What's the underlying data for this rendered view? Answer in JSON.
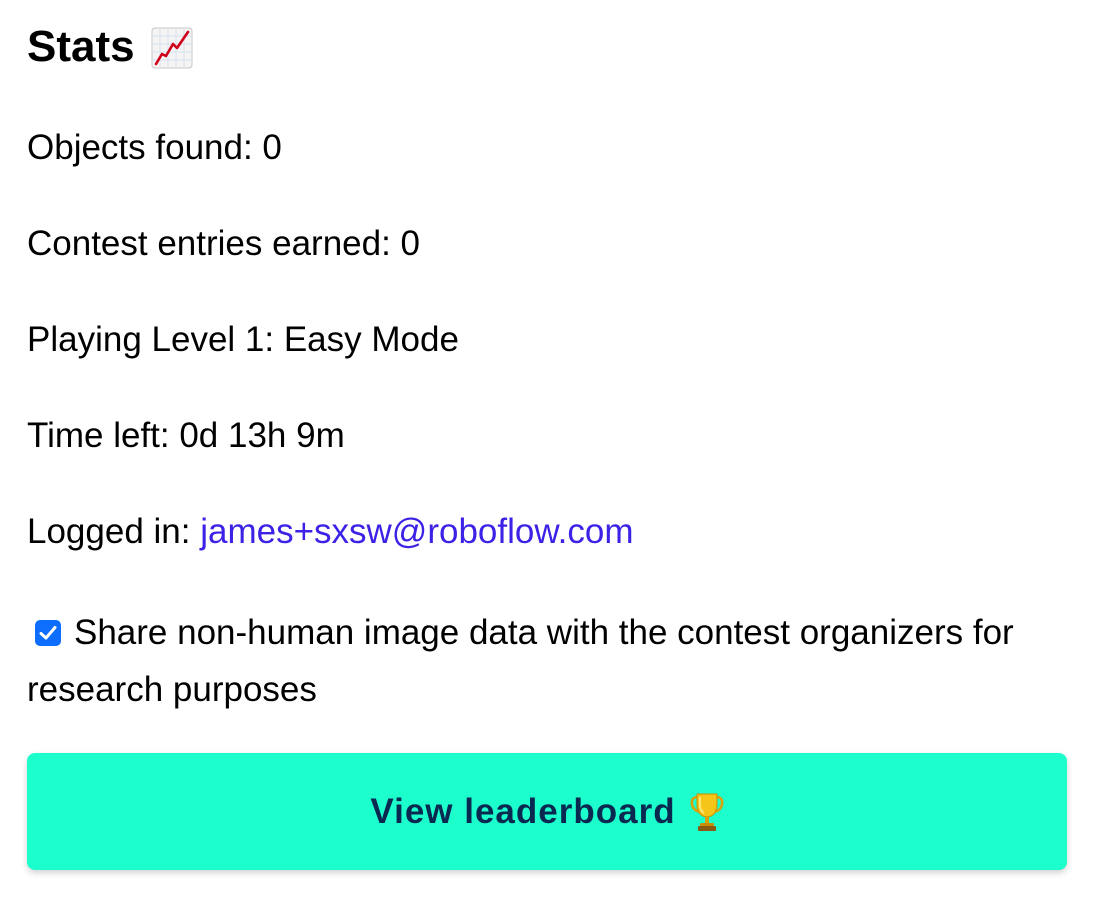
{
  "stats": {
    "title": "Stats",
    "title_icon": "chart-increasing-icon",
    "objects_found": "Objects found: 0",
    "contest_entries": "Contest entries earned: 0",
    "level": "Playing Level 1: Easy Mode",
    "time_left": "Time left: 0d 13h 9m",
    "logged_in_label": "Logged in: ",
    "logged_in_email": "james+sxsw@roboflow.com",
    "share_label": "Share non-human image data with the contest organizers for research purposes",
    "share_checked": true,
    "leaderboard_label": "View leaderboard",
    "leaderboard_icon": "trophy-icon"
  },
  "colors": {
    "link": "#3c21e6",
    "button_bg": "#1cffcc",
    "button_text": "#0a2950",
    "checkbox": "#0d6efd"
  }
}
